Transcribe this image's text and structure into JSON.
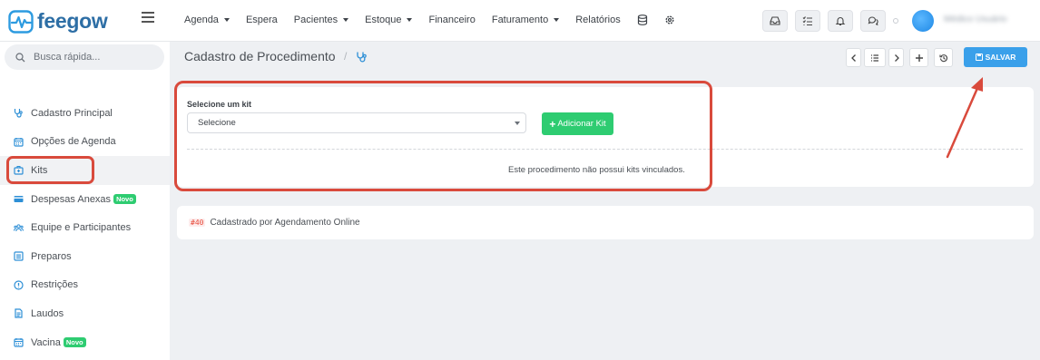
{
  "app": {
    "brand": "feegow",
    "brand_color": "#2d6ea5"
  },
  "topbar": {
    "nav": [
      {
        "label": "Agenda",
        "dropdown": true
      },
      {
        "label": "Espera",
        "dropdown": false
      },
      {
        "label": "Pacientes",
        "dropdown": true
      },
      {
        "label": "Estoque",
        "dropdown": true
      },
      {
        "label": "Financeiro",
        "dropdown": false
      },
      {
        "label": "Faturamento",
        "dropdown": true
      },
      {
        "label": "Relatórios",
        "dropdown": false
      }
    ],
    "extra_icons": [
      "database-icon",
      "gear-icon"
    ],
    "action_icons": [
      "inbox-icon",
      "checklist-icon",
      "bell-icon",
      "chat-icon"
    ],
    "user_name": "Médico Usuário"
  },
  "sidebar": {
    "search_placeholder": "Busca rápida...",
    "items": [
      {
        "label": "Cadastro Principal",
        "icon": "stethoscope-icon",
        "badge": ""
      },
      {
        "label": "Opções de Agenda",
        "icon": "calendar-icon",
        "badge": ""
      },
      {
        "label": "Kits",
        "icon": "medkit-icon",
        "badge": "",
        "active": true
      },
      {
        "label": "Despesas Anexas",
        "icon": "credit-card-icon",
        "badge": "Novo"
      },
      {
        "label": "Equipe e Participantes",
        "icon": "team-icon",
        "badge": ""
      },
      {
        "label": "Preparos",
        "icon": "list-icon",
        "badge": ""
      },
      {
        "label": "Restrições",
        "icon": "info-icon",
        "badge": ""
      },
      {
        "label": "Laudos",
        "icon": "document-icon",
        "badge": ""
      },
      {
        "label": "Vacina",
        "icon": "calendar-icon",
        "badge": "Novo"
      }
    ]
  },
  "header": {
    "title": "Cadastro de Procedimento",
    "separator": "/",
    "title_icon": "stethoscope-icon",
    "tools": [
      "prev-icon",
      "list-icon",
      "next-icon",
      "plus-icon",
      "history-icon"
    ],
    "save_label": "SALVAR"
  },
  "kit_card": {
    "label": "Selecione um kit",
    "select_value": "Selecione",
    "add_label": "Adicionar Kit",
    "empty_message": "Este procedimento não possui kits vinculados."
  },
  "source_card": {
    "code": "#40",
    "text": "Cadastrado por Agendamento Online"
  },
  "colors": {
    "accent_blue": "#3aa0ea",
    "success_green": "#2ecc71",
    "annotation_red": "#d94a3c"
  }
}
